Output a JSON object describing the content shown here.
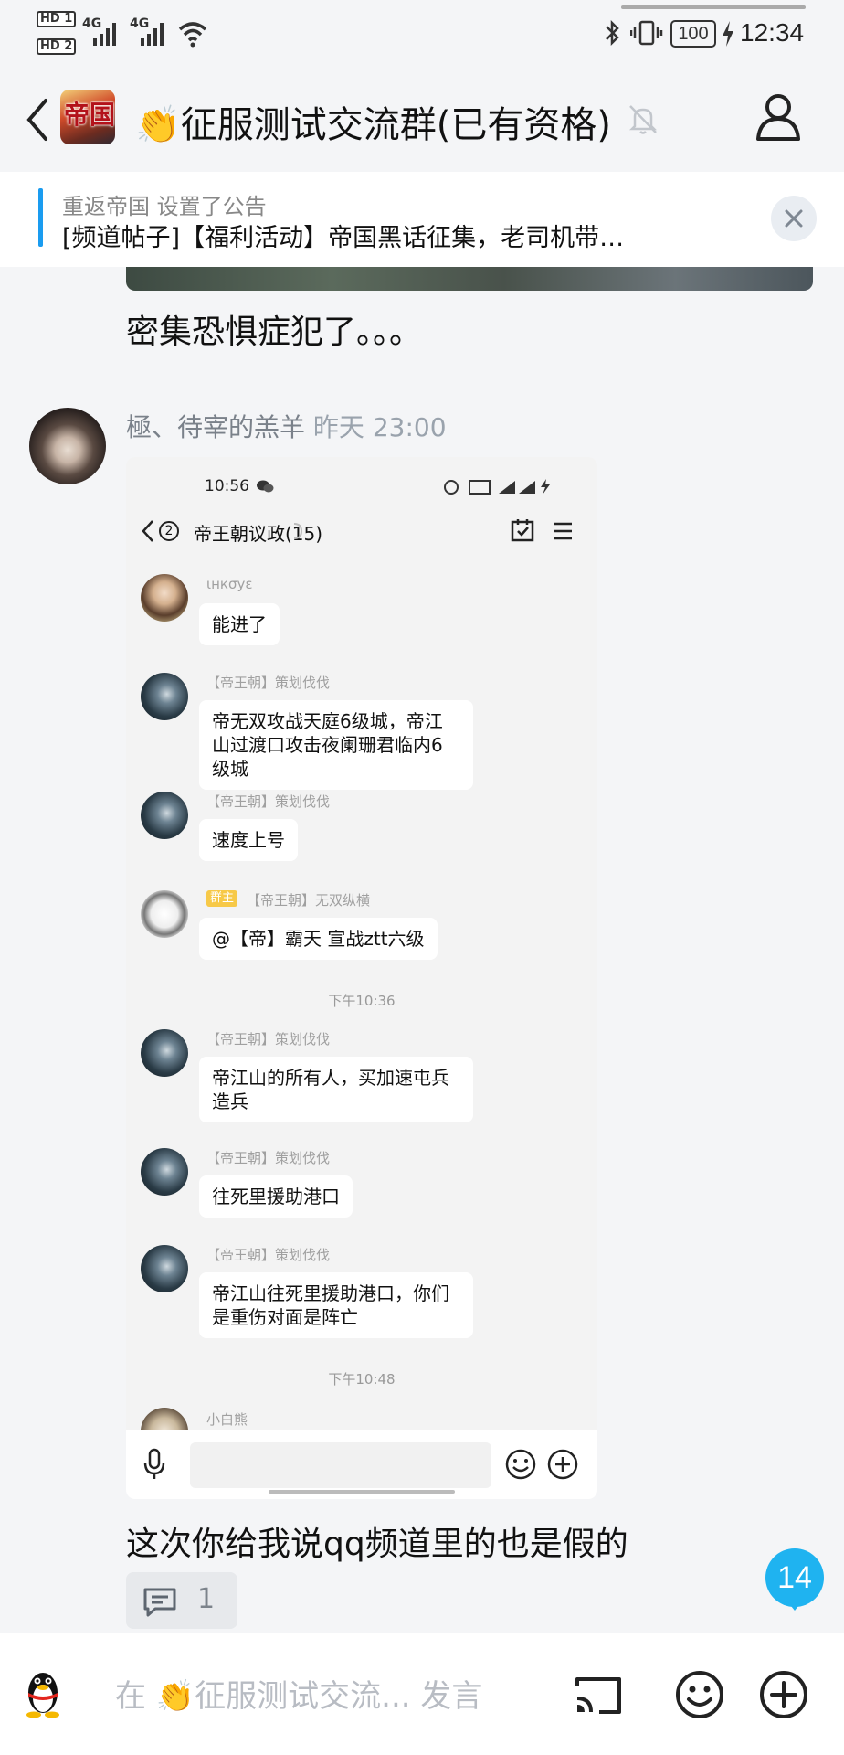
{
  "status_bar": {
    "hd1": "HD 1",
    "hd2": "HD 2",
    "net1": "4G",
    "net2": "4G",
    "battery": "100",
    "time": "12:34"
  },
  "header": {
    "title": "👏征服测试交流群(已有资格)",
    "group_icon_text": "帝国"
  },
  "announcement": {
    "author_line": "重返帝国  设置了公告",
    "text": "[频道帖子]【福利活动】帝国黑话征集，老司机带…"
  },
  "messages": [
    {
      "text": "密集恐惧症犯了。。。"
    },
    {
      "sender": "極、待宰的羔羊",
      "time": "昨天 23:00",
      "caption": "这次你给我说qq频道里的也是假的",
      "comment_count": "1"
    }
  ],
  "screenshot": {
    "time": "10:56",
    "chat_title": "帝王朝议政(15)",
    "back_count": "2",
    "messages": [
      {
        "name": "ιнкσуε",
        "text": "能进了"
      },
      {
        "name": "【帝王朝】策划伐伐",
        "text": "帝无双攻战天庭6级城，帝江山过渡口攻击夜阑珊君临内6级城"
      },
      {
        "name": "【帝王朝】策划伐伐",
        "text": "速度上号"
      },
      {
        "badge": "群主",
        "name": "【帝王朝】无双纵横",
        "text": "@【帝】霸天 宣战ztt六级"
      },
      {
        "name": "【帝王朝】策划伐伐",
        "text": "帝江山的所有人，买加速屯兵造兵"
      },
      {
        "name": "【帝王朝】策划伐伐",
        "text": "往死里援助港口"
      },
      {
        "name": "【帝王朝】策划伐伐",
        "text": "帝江山往死里援助港口，你们是重伤对面是阵亡"
      },
      {
        "name": "小白熊",
        "text": ""
      }
    ],
    "time_sep_1": "下午10:36",
    "time_sep_2": "下午10:48"
  },
  "unread_badge": "14",
  "input": {
    "placeholder": "在 👏征服测试交流... 发言"
  },
  "colors": {
    "accent": "#1a9cf0",
    "badge": "#1fb3f0",
    "background": "#f4f5f7"
  }
}
